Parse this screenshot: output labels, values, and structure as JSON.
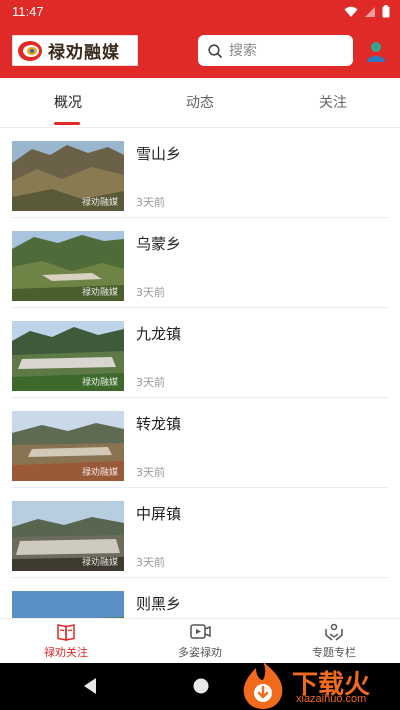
{
  "status_bar": {
    "time": "11:47"
  },
  "header": {
    "logo_text": "禄劝融媒",
    "search_placeholder": "搜索",
    "accent_color": "#e02a27"
  },
  "tabs": [
    {
      "label": "概况",
      "active": true
    },
    {
      "label": "动态",
      "active": false
    },
    {
      "label": "关注",
      "active": false
    }
  ],
  "news": [
    {
      "title": "雪山乡",
      "time": "3天前"
    },
    {
      "title": "乌蒙乡",
      "time": "3天前"
    },
    {
      "title": "九龙镇",
      "time": "3天前"
    },
    {
      "title": "转龙镇",
      "time": "3天前"
    },
    {
      "title": "中屏镇",
      "time": "3天前"
    },
    {
      "title": "则黑乡",
      "time": ""
    }
  ],
  "thumb_watermark": "禄劝融媒",
  "bottom_nav": [
    {
      "label": "禄劝关注",
      "icon": "book-icon",
      "active": true
    },
    {
      "label": "多姿禄劝",
      "icon": "video-icon",
      "active": false
    },
    {
      "label": "专题专栏",
      "icon": "hands-icon",
      "active": false
    }
  ],
  "overlay_watermark": {
    "text": "下载火",
    "domain": "xiazaihuo.com"
  }
}
